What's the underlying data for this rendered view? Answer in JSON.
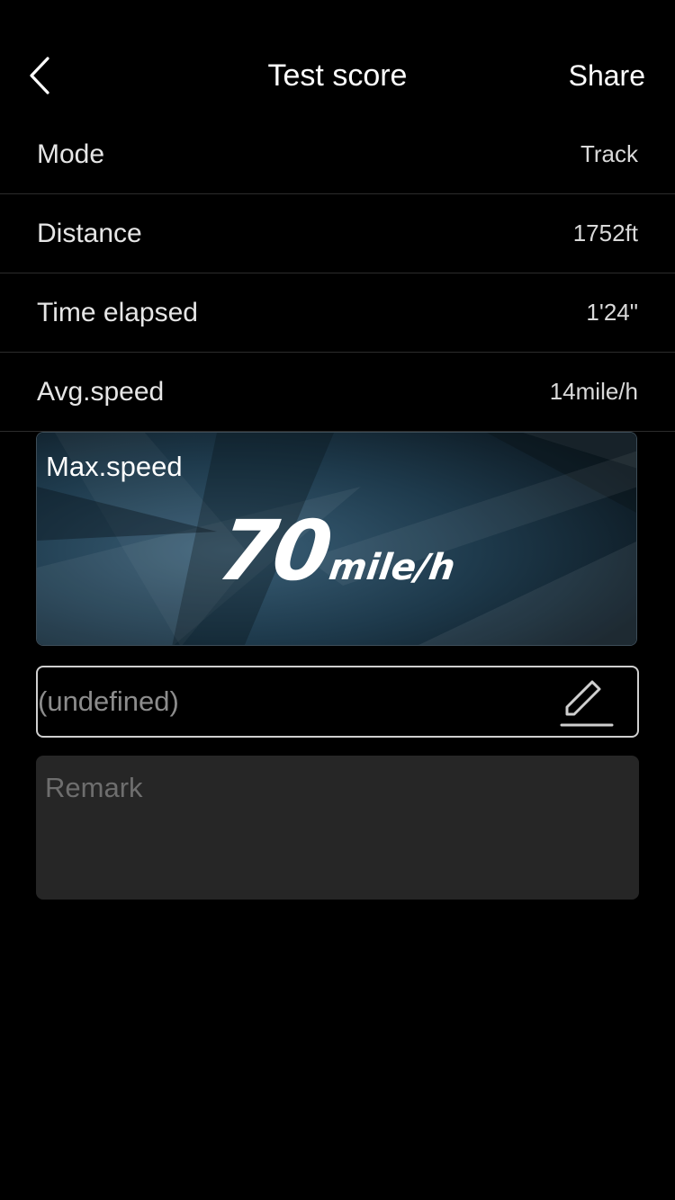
{
  "nav": {
    "back_icon": "chevron-left-icon",
    "title": "Test score",
    "share_label": "Share"
  },
  "stats": [
    {
      "label": "Mode",
      "value": "Track"
    },
    {
      "label": "Distance",
      "value": "1752ft"
    },
    {
      "label": "Time elapsed",
      "value": "1'24\""
    },
    {
      "label": "Avg.speed",
      "value": "14mile/h"
    }
  ],
  "max_speed": {
    "label": "Max.speed",
    "value": "70",
    "unit": "mile/h"
  },
  "name_field": {
    "placeholder": "(undefined)",
    "edit_icon": "pencil-edit-icon"
  },
  "remark": {
    "placeholder": "Remark"
  },
  "colors": {
    "background": "#000000",
    "divider": "#2c2c2c",
    "remark_bg": "#262626",
    "card_accent": "#2d4e63"
  }
}
